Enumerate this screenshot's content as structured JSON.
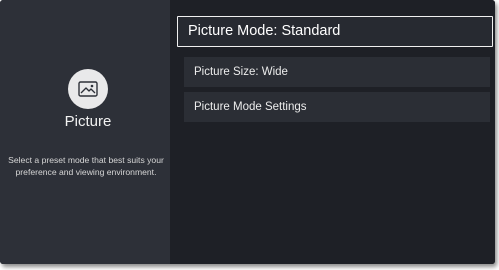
{
  "category": {
    "icon": "picture-icon",
    "title": "Picture",
    "description": "Select a preset mode that best suits your preference and viewing environment."
  },
  "menu": {
    "items": [
      {
        "label": "Picture Mode: Standard",
        "selected": true
      },
      {
        "label": "Picture Size: Wide",
        "selected": false
      },
      {
        "label": "Picture Mode Settings",
        "selected": false
      }
    ]
  },
  "colors": {
    "background": "#1e2026",
    "left_panel": "#2d3038",
    "menu_item": "#2b2e35",
    "focus_border": "#f0f0f0"
  }
}
